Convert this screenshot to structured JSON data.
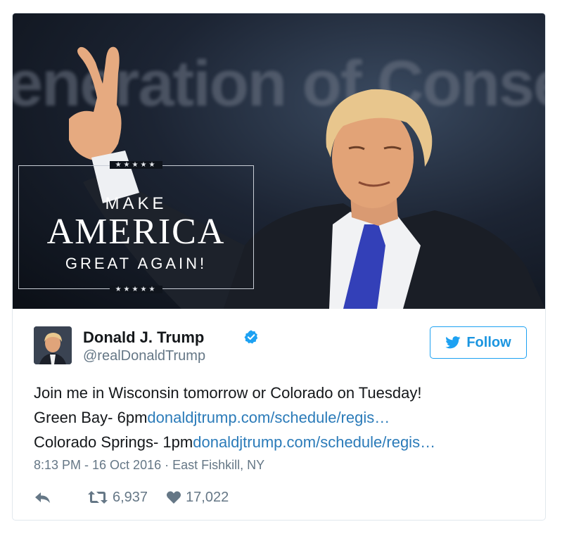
{
  "media": {
    "banner_text": "eneration of Conse",
    "maga_stars": "★★★★★",
    "maga_line1": "MAKE",
    "maga_line2": "AMERICA",
    "maga_line3": "GREAT AGAIN!"
  },
  "author": {
    "name": "Donald J. Trump",
    "handle": "@realDonaldTrump",
    "verified_icon": "verified-badge-icon"
  },
  "follow_button": {
    "label": "Follow",
    "icon": "twitter-bird-icon"
  },
  "tweet": {
    "line1": "Join me in Wisconsin tomorrow or Colorado on Tuesday!",
    "line2_text": "Green Bay- 6pm",
    "line2_link": "donaldjtrump.com/schedule/regis…",
    "line3_text": "Colorado Springs- 1pm",
    "line3_link": "donaldjtrump.com/schedule/regis…"
  },
  "meta": {
    "timestamp": "8:13 PM - 16 Oct 2016",
    "separator": " · ",
    "location": "East Fishkill, NY"
  },
  "actions": {
    "reply_icon": "reply-icon",
    "retweet_icon": "retweet-icon",
    "retweet_count": "6,937",
    "like_icon": "heart-icon",
    "like_count": "17,022"
  },
  "colors": {
    "link": "#2b7bb9",
    "twitter_blue": "#1da1f2",
    "muted": "#657786",
    "text": "#14171a",
    "tie": "#3340b8"
  }
}
